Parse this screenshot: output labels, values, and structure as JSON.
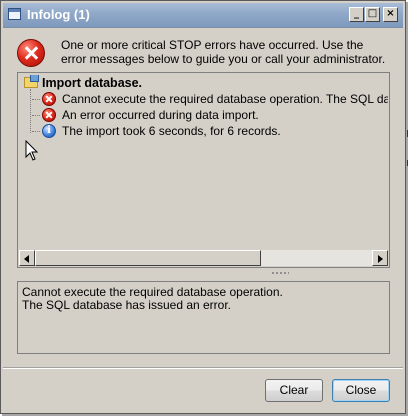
{
  "window": {
    "title": "Infolog (1)",
    "controls": {
      "minimize": "_",
      "maximize": "□",
      "close": "×"
    }
  },
  "header": {
    "icon": "stop-error-icon",
    "message": "One or more critical STOP errors have occurred. Use the error messages below to guide you or call your administrator."
  },
  "tree": {
    "root": {
      "label": "Import database.",
      "icon": "folder-icon"
    },
    "items": [
      {
        "icon": "error-icon",
        "label": "Cannot execute the required database operation. The SQL database"
      },
      {
        "icon": "error-icon",
        "label": "An error occurred during data import."
      },
      {
        "icon": "info-icon",
        "label": "The import took 6 seconds, for 6 records."
      }
    ]
  },
  "details": {
    "lines": [
      "Cannot execute the required database operation.",
      "The SQL database has issued an error."
    ]
  },
  "buttons": {
    "clear": "Clear",
    "close": "Close"
  },
  "colors": {
    "title_bar": "#8fa8c8",
    "error_red": "#e02b1e",
    "info_blue": "#3b7dd8",
    "dialog_bg": "#d4d0c8"
  }
}
